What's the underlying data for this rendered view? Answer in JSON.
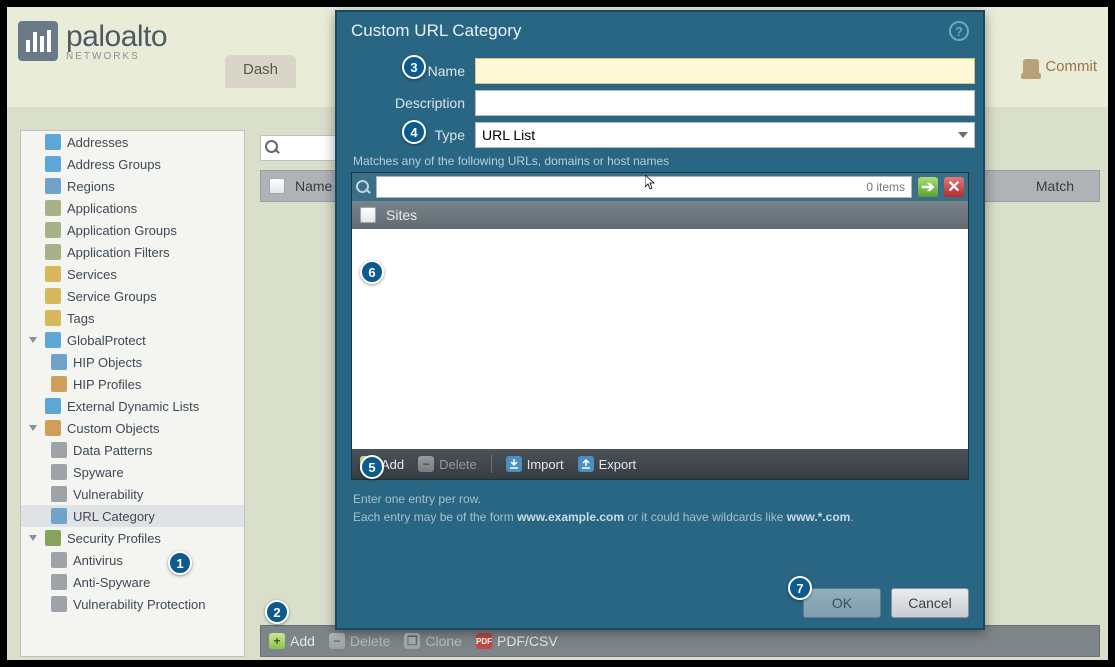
{
  "logo": {
    "brand": "paloalto",
    "sub": "NETWORKS"
  },
  "topTab": {
    "dashboard": "Dash"
  },
  "commit": {
    "label": "Commit"
  },
  "sidebar": {
    "items": [
      {
        "label": "Addresses",
        "icon": "#5ca7d6",
        "level": 1
      },
      {
        "label": "Address Groups",
        "icon": "#5ca7d6",
        "level": 1
      },
      {
        "label": "Regions",
        "icon": "#6fa3c9",
        "level": 1
      },
      {
        "label": "Applications",
        "icon": "#a8b28a",
        "level": 1
      },
      {
        "label": "Application Groups",
        "icon": "#a8b28a",
        "level": 1
      },
      {
        "label": "Application Filters",
        "icon": "#a8b28a",
        "level": 1
      },
      {
        "label": "Services",
        "icon": "#d6b95c",
        "level": 1
      },
      {
        "label": "Service Groups",
        "icon": "#d6b95c",
        "level": 1
      },
      {
        "label": "Tags",
        "icon": "#d6b95c",
        "level": 1
      },
      {
        "label": "GlobalProtect",
        "icon": "#5ca7d6",
        "level": 1,
        "exp": true
      },
      {
        "label": "HIP Objects",
        "icon": "#6fa3c9",
        "level": 2
      },
      {
        "label": "HIP Profiles",
        "icon": "#cfa05c",
        "level": 2
      },
      {
        "label": "External Dynamic Lists",
        "icon": "#5ca7d6",
        "level": 1
      },
      {
        "label": "Custom Objects",
        "icon": "#cfa05c",
        "level": 1,
        "exp": true
      },
      {
        "label": "Data Patterns",
        "icon": "#9da3a7",
        "level": 2
      },
      {
        "label": "Spyware",
        "icon": "#9da3a7",
        "level": 2
      },
      {
        "label": "Vulnerability",
        "icon": "#9da3a7",
        "level": 2
      },
      {
        "label": "URL Category",
        "icon": "#6fa3c9",
        "level": 2,
        "selected": true
      },
      {
        "label": "Security Profiles",
        "icon": "#8aa35c",
        "level": 1,
        "exp": true
      },
      {
        "label": "Antivirus",
        "icon": "#9da3a7",
        "level": 2
      },
      {
        "label": "Anti-Spyware",
        "icon": "#9da3a7",
        "level": 2
      },
      {
        "label": "Vulnerability Protection",
        "icon": "#9da3a7",
        "level": 2
      }
    ]
  },
  "grid": {
    "col_name": "Name",
    "col_match": "Match"
  },
  "bottomBar": {
    "add": "Add",
    "delete": "Delete",
    "clone": "Clone",
    "pdfcsv": "PDF/CSV"
  },
  "dialog": {
    "title": "Custom URL Category",
    "labels": {
      "name": "Name",
      "description": "Description",
      "type": "Type"
    },
    "values": {
      "name": "",
      "description": "",
      "type": "URL List"
    },
    "match_hint": "Matches any of the following URLs, domains or host names",
    "sites": {
      "count": "0 items",
      "header": "Sites",
      "toolbar": {
        "add": "Add",
        "delete": "Delete",
        "import": "Import",
        "export": "Export"
      }
    },
    "hint_line1": "Enter one entry per row.",
    "hint_line2_a": "Each entry may be of the form ",
    "hint_line2_b": "www.example.com",
    "hint_line2_c": " or it could have wildcards like ",
    "hint_line2_d": "www.*.com",
    "hint_line2_e": ".",
    "buttons": {
      "ok": "OK",
      "cancel": "Cancel"
    }
  },
  "callouts": {
    "c1": "1",
    "c2": "2",
    "c3": "3",
    "c4": "4",
    "c5": "5",
    "c6": "6",
    "c7": "7"
  }
}
